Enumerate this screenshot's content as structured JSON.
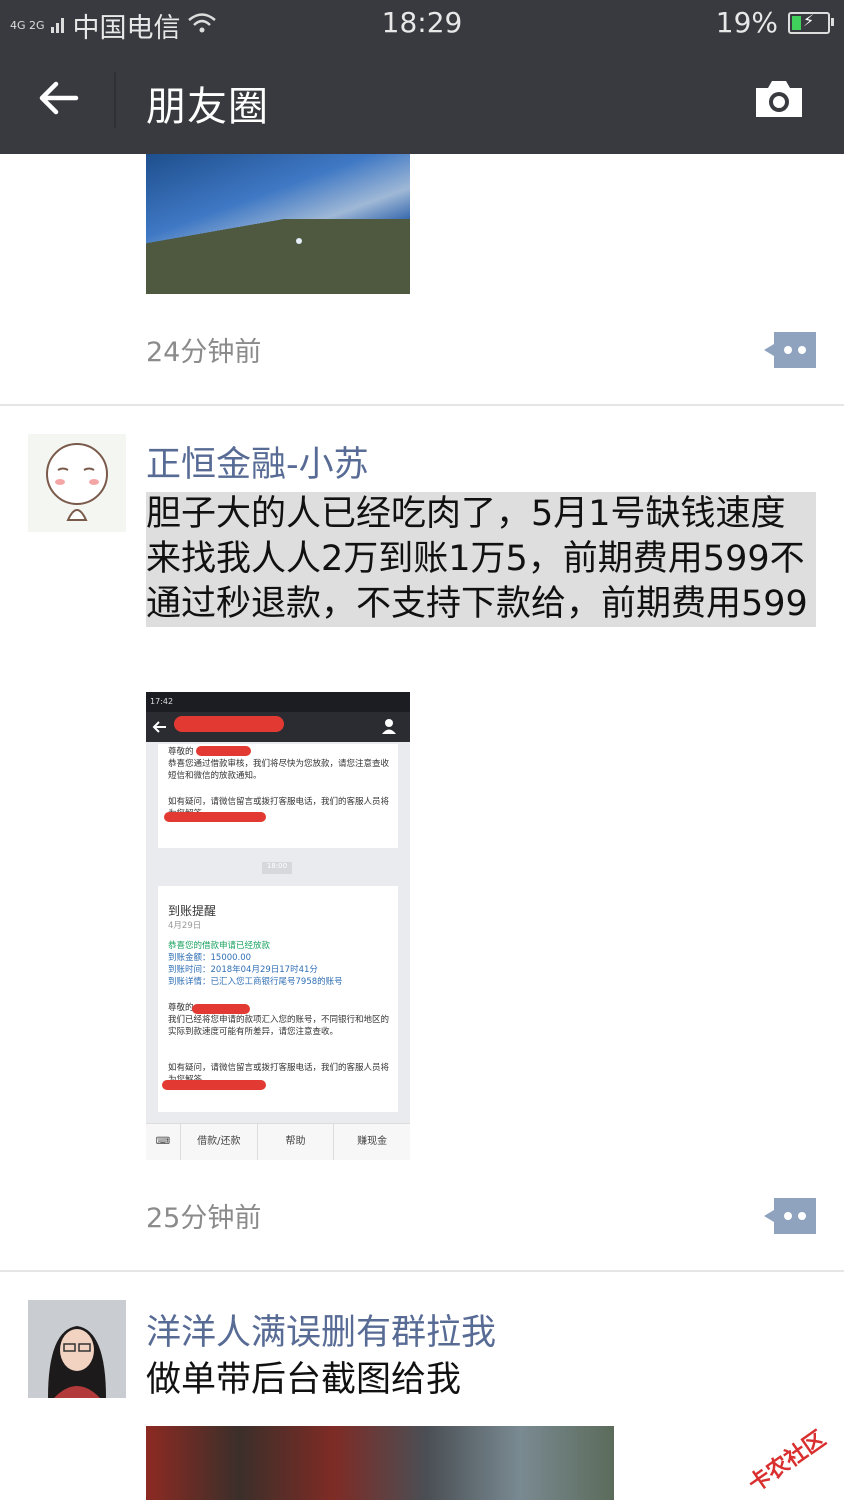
{
  "status_bar": {
    "network": "4G 2G",
    "carrier": "中国电信",
    "time": "18:29",
    "battery": "19%",
    "battery_level": 0.19
  },
  "nav": {
    "title": "朋友圈"
  },
  "posts": [
    {
      "timestamp": "24分钟前"
    },
    {
      "author": "正恒金融-小苏",
      "text": "胆子大的人已经吃肉了，5月1号缺钱速度来找我人人2万到账1万5，前期费用599不通过秒退款，不支持下款给，前期费用599",
      "timestamp": "25分钟前",
      "screenshot": {
        "status_time": "17:42",
        "msg1_greeting": "尊敬的",
        "msg1_body": "恭喜您通过借款审核，我们将尽快为您放款，请您注意查收短信和微信的放款通知。",
        "msg1_footer": "如有疑问，请微信留言或拨打客服电话，我们的客服人员将为您解答。",
        "center_time": "18:00",
        "msg2_title": "到账提醒",
        "msg2_date": "4月29日",
        "msg2_line1": "恭喜您的借款申请已经放款",
        "msg2_amount": "到账金额：15000.00",
        "msg2_time": "到账时间：2018年04月29日17时41分",
        "msg2_detail": "到账详情：已汇入您工商银行尾号7958的账号",
        "msg2_greeting": "尊敬的",
        "msg2_body": "我们已经将您申请的款项汇入您的账号，不同银行和地区的实际到款速度可能有所差异，请您注意查收。",
        "msg2_footer": "如有疑问，请微信留言或拨打客服电话，我们的客服人员将为您解答。",
        "tabs": [
          "借款/还款",
          "帮助",
          "赚现金"
        ]
      }
    },
    {
      "author": "洋洋人满误删有群拉我",
      "text": "做单带后台截图给我"
    }
  ],
  "watermark": "卡农社区"
}
